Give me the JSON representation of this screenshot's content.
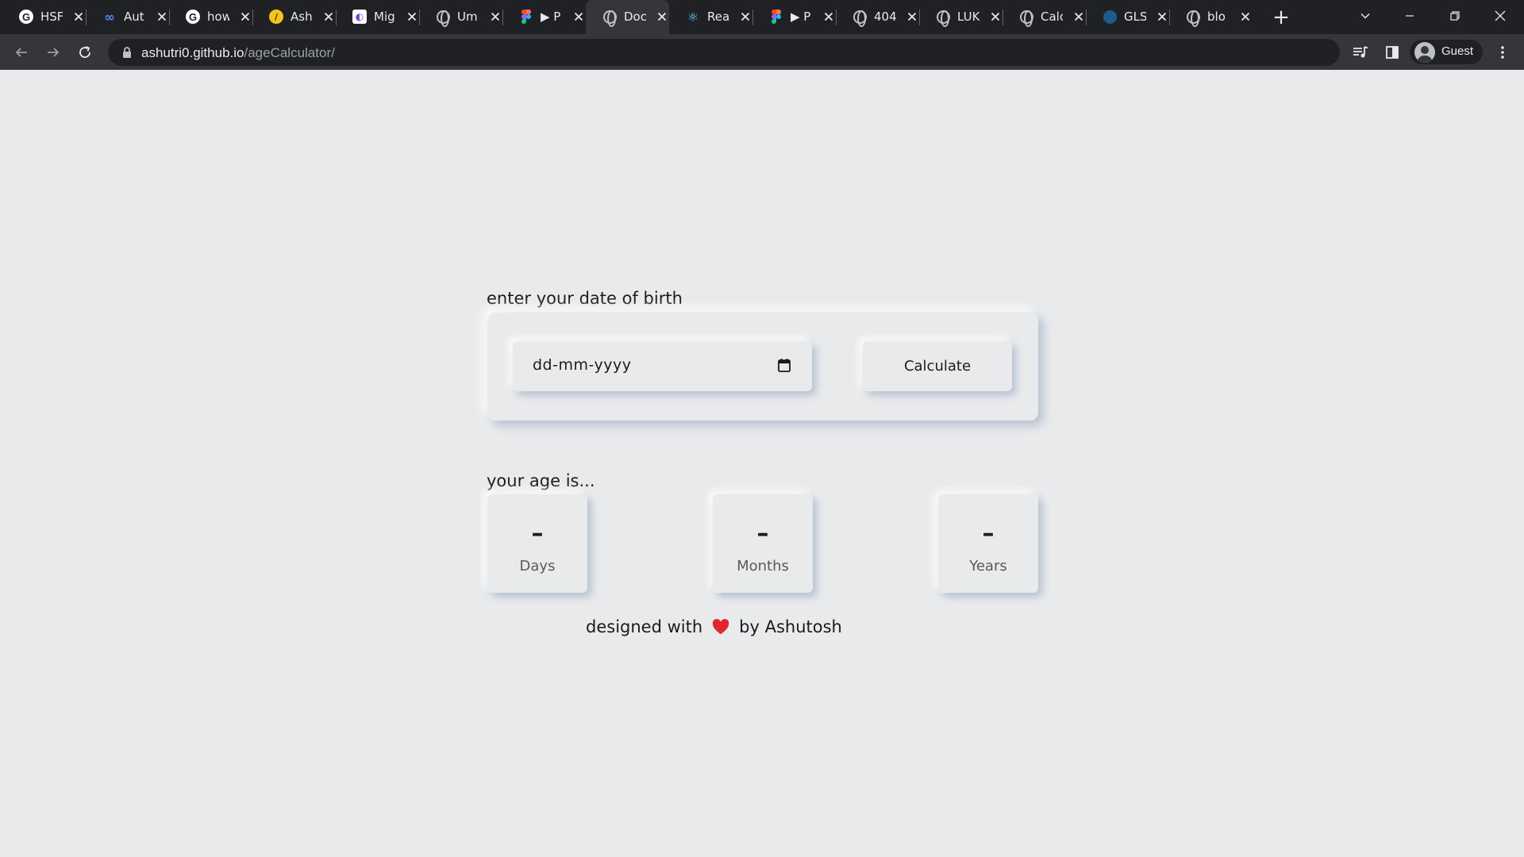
{
  "browser": {
    "tabs": [
      {
        "title": "HSF",
        "icon": "google-icon"
      },
      {
        "title": "Aut",
        "icon": "meta-icon"
      },
      {
        "title": "how",
        "icon": "google-icon"
      },
      {
        "title": "Ash",
        "icon": "yellow-logo-icon"
      },
      {
        "title": "Mig",
        "icon": "migration-icon"
      },
      {
        "title": "Um",
        "icon": "globe-icon"
      },
      {
        "title": "▶ P",
        "icon": "figma-icon"
      },
      {
        "title": "Doc",
        "icon": "globe-icon",
        "active": true
      },
      {
        "title": "Rea",
        "icon": "react-icon"
      },
      {
        "title": "▶ P",
        "icon": "figma-icon"
      },
      {
        "title": "404",
        "icon": "globe-icon"
      },
      {
        "title": "LUK",
        "icon": "globe-icon"
      },
      {
        "title": "Calc",
        "icon": "globe-icon"
      },
      {
        "title": "GLS",
        "icon": "blue-dot-icon"
      },
      {
        "title": "blo",
        "icon": "globe-icon"
      }
    ],
    "url_host": "ashutri0.github.io",
    "url_path": "/ageCalculator/",
    "profile_label": "Guest"
  },
  "page": {
    "dob_heading": "enter your date of birth",
    "date_placeholder": "dd-mm-yyyy",
    "calculate_label": "Calculate",
    "age_heading": "your age is...",
    "age": {
      "days_value": "–",
      "days_label": "Days",
      "months_value": "–",
      "months_label": "Months",
      "years_value": "–",
      "years_label": "Years"
    },
    "credit_prefix": "designed with",
    "credit_suffix": "by Ashutosh"
  },
  "colors": {
    "page_bg": "#e9eaec",
    "tabbar_bg": "#202124",
    "toolbar_bg": "#35363a",
    "heart": "#e0262e"
  }
}
